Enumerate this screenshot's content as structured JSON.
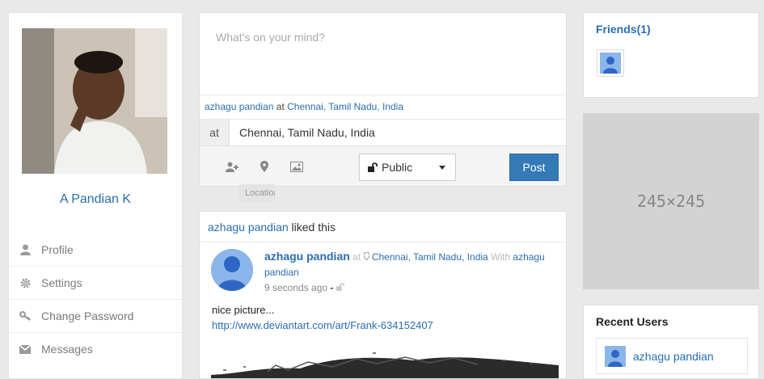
{
  "profile": {
    "name": "A Pandian K",
    "menu": [
      {
        "label": "Profile",
        "icon": "user-icon"
      },
      {
        "label": "Settings",
        "icon": "gear-icon"
      },
      {
        "label": "Change Password",
        "icon": "key-icon"
      },
      {
        "label": "Messages",
        "icon": "envelope-icon"
      }
    ]
  },
  "composer": {
    "placeholder": "What's on your mind?",
    "loc_user": "azhagu pandian",
    "loc_at": "at",
    "loc_place": "Chennai, Tamil Nadu, India",
    "at_label": "at",
    "at_value": "Chennai, Tamil Nadu, India",
    "privacy": "Public",
    "post_label": "Post",
    "tooltip": "Location"
  },
  "feed": {
    "header_user": "azhagu pandian",
    "header_action": "liked this",
    "post": {
      "author": "azhagu pandian",
      "at": "at",
      "location": "Chennai, Tamil Nadu, India",
      "with": "With",
      "with_user_1": "azhagu",
      "with_user_2": "pandian",
      "time": "9 seconds ago",
      "dash": "-",
      "text": "nice picture...",
      "link": "http://www.deviantart.com/art/Frank-634152407"
    }
  },
  "friends": {
    "title": "Friends(1)"
  },
  "ad": {
    "label": "245×245"
  },
  "recent": {
    "title": "Recent Users",
    "users": [
      "azhagu pandian"
    ]
  },
  "colors": {
    "accent": "#337ab7",
    "link": "#2a6db0",
    "page_bg": "#e9e9e9"
  }
}
